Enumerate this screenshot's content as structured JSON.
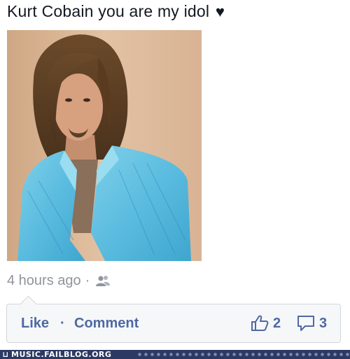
{
  "post": {
    "text": "Kurt Cobain you are my idol",
    "heart_glyph": "♥",
    "photo_subject": "long-haired-man-in-blue-shirt"
  },
  "meta": {
    "timestamp": "4 hours ago",
    "separator": "·",
    "audience_icon": "friends-icon"
  },
  "actions": {
    "like_label": "Like",
    "separator": "·",
    "comment_label": "Comment",
    "like_count": "2",
    "comment_count": "3",
    "like_icon": "thumbs-up-icon",
    "comment_icon": "comment-bubble-icon"
  },
  "watermark": {
    "text": "MUSIC.FAILBLOG.ORG",
    "icon_glyph": "⊔"
  },
  "colors": {
    "link": "#4e69a2",
    "meta_text": "#90949c",
    "bar_bg": "#f6f7f9",
    "watermark_bg": "#2c3a63"
  }
}
